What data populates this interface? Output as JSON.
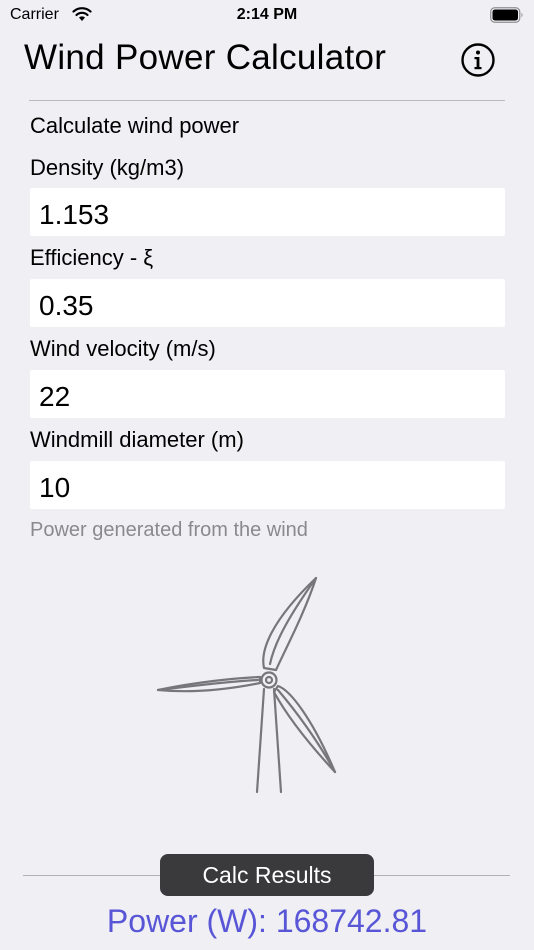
{
  "status_bar": {
    "carrier": "Carrier",
    "time": "2:14 PM",
    "wifi_icon": "wifi-icon",
    "battery_icon": "battery-icon"
  },
  "nav": {
    "title": "Wind Power Calculator",
    "info_icon": "info-circle-icon"
  },
  "form": {
    "section_title": "Calculate wind power",
    "fields": [
      {
        "label": "Density (kg/m3)",
        "value": "1.153"
      },
      {
        "label": "Efficiency - ξ",
        "value": "0.35"
      },
      {
        "label": "Wind velocity (m/s)",
        "value": "22"
      },
      {
        "label": "Windmill diameter (m)",
        "value": "10"
      }
    ],
    "caption": "Power generated from the wind"
  },
  "illustration": {
    "icon": "wind-turbine-icon"
  },
  "actions": {
    "calc_label": "Calc Results"
  },
  "result": {
    "text": "Power (W): 168742.81"
  },
  "colors": {
    "background": "#efeff4",
    "result_text": "#5856d6",
    "button_bg": "#3a3a3c",
    "caption_text": "#8a8a8e"
  }
}
